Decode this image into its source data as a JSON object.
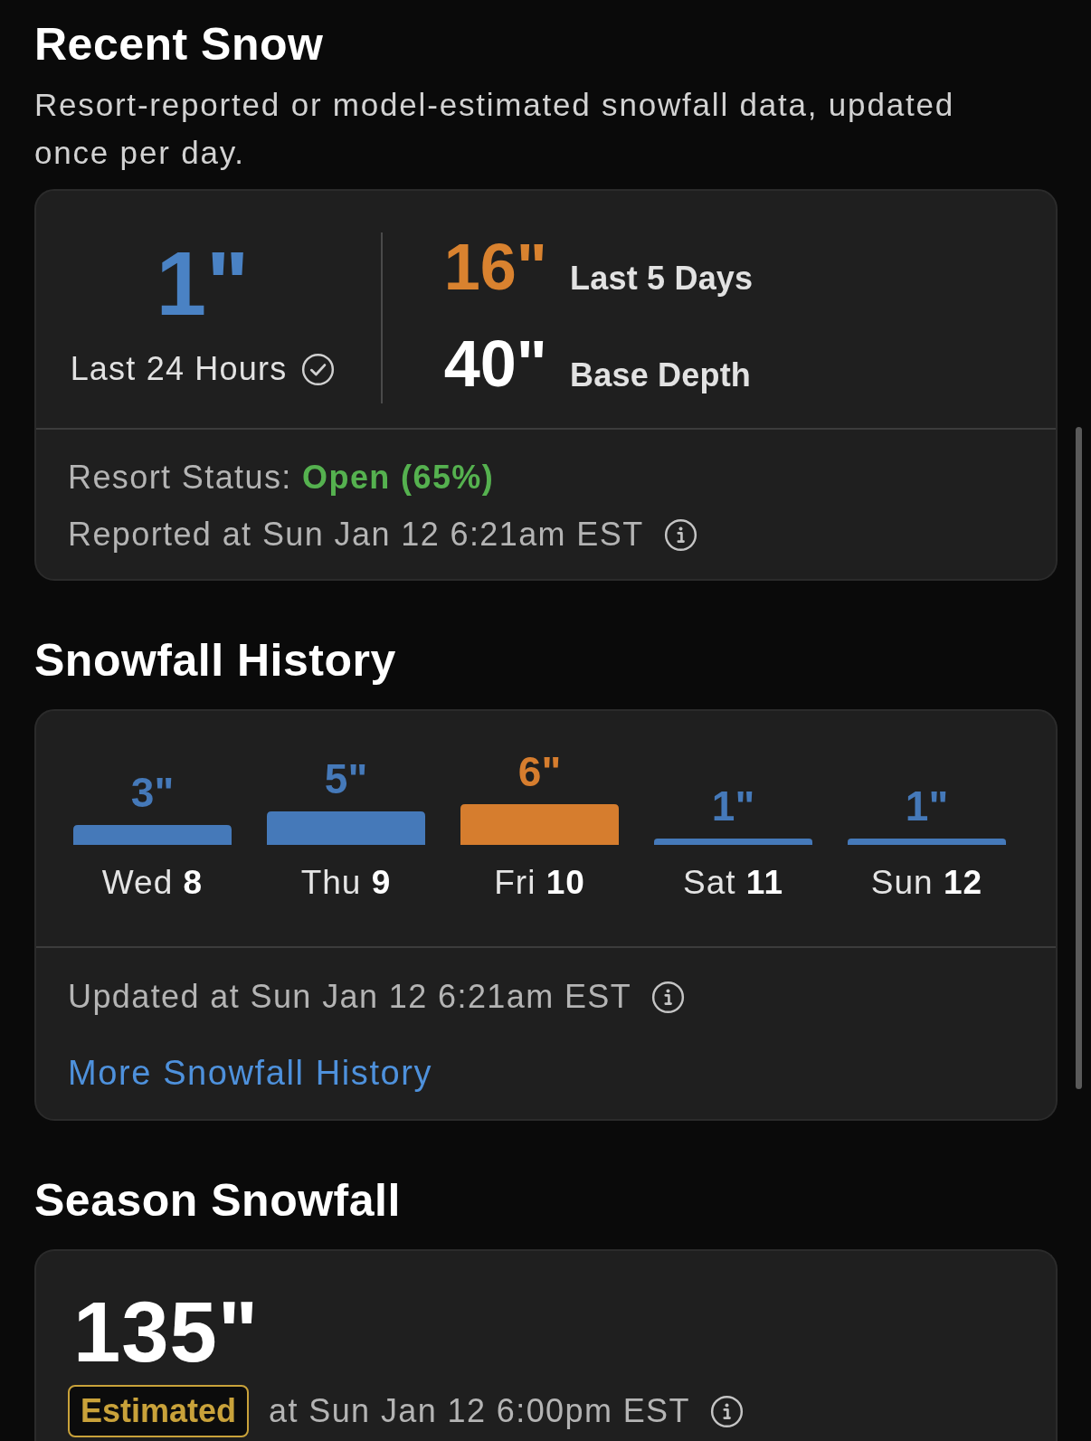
{
  "recent_snow": {
    "title": "Recent Snow",
    "subtitle": "Resort-reported or model-estimated snowfall data, updated once per day.",
    "last_24_hours": {
      "value": "1\"",
      "label": "Last 24 Hours"
    },
    "stats": [
      {
        "value": "16\"",
        "label": "Last 5 Days",
        "color": "#d9822f"
      },
      {
        "value": "40\"",
        "label": "Base Depth",
        "color": "#ffffff"
      }
    ],
    "status": {
      "label": "Resort Status:",
      "value": "Open (65%)",
      "kind": "open"
    },
    "reported": "Reported at Sun Jan 12 6:21am EST"
  },
  "snowfall_history": {
    "title": "Snowfall History",
    "chart_data": {
      "type": "bar",
      "categories": [
        "Wed **8**",
        "Thu **9**",
        "Fri **10**",
        "Sat **11**",
        "Sun **12**"
      ],
      "series": [
        {
          "color": "#4579b9",
          "values": [
            3,
            5,
            null,
            1,
            1
          ],
          "value_labels": [
            "3\"",
            "5\"",
            null,
            "1\"",
            "1\""
          ]
        },
        {
          "color": "#d67d2e",
          "values": [
            null,
            null,
            6,
            null,
            null
          ],
          "value_labels": [
            null,
            null,
            "6\"",
            null,
            null
          ]
        }
      ]
    },
    "updated": "Updated at Sun Jan 12 6:21am EST",
    "link": "More Snowfall History"
  },
  "season_snowfall": {
    "title": "Season Snowfall",
    "value": "135\"",
    "badge": "Estimated",
    "timestamp": "at Sun Jan 12 6:00pm EST"
  }
}
